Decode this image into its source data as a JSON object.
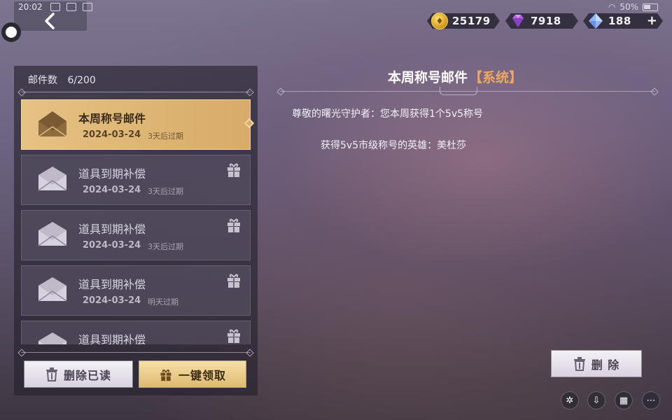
{
  "status_bar": {
    "time": "20:02",
    "battery": "50%"
  },
  "currencies": {
    "gold": {
      "icon": "coin-icon",
      "value": "25179"
    },
    "diamond": {
      "icon": "purple-diamond-icon",
      "value": "7918"
    },
    "gem": {
      "icon": "blue-crystal-icon",
      "value": "188",
      "add": "+"
    }
  },
  "mail_panel": {
    "count_label": "邮件数",
    "count_value": "6/200",
    "items": [
      {
        "title": "本周称号邮件",
        "date": "2024-03-24",
        "expire": "3天后过期",
        "selected": true
      },
      {
        "title": "道具到期补偿",
        "date": "2024-03-24",
        "expire": "3天后过期"
      },
      {
        "title": "道具到期补偿",
        "date": "2024-03-24",
        "expire": "3天后过期"
      },
      {
        "title": "道具到期补偿",
        "date": "2024-03-24",
        "expire": "明天过期"
      },
      {
        "title": "道具到期补偿",
        "date": "",
        "expire": ""
      }
    ],
    "delete_read_label": "删除已读",
    "claim_all_label": "一键领取"
  },
  "detail": {
    "title": "本周称号邮件",
    "tag": "【系统】",
    "line1": "尊敬的曙光守护者：您本周获得1个5v5称号",
    "line2": "获得5v5市级称号的英雄：美杜莎",
    "delete_label": "删 除"
  },
  "colors": {
    "selected_item": "#ddb472",
    "tag": "#f0a860"
  }
}
